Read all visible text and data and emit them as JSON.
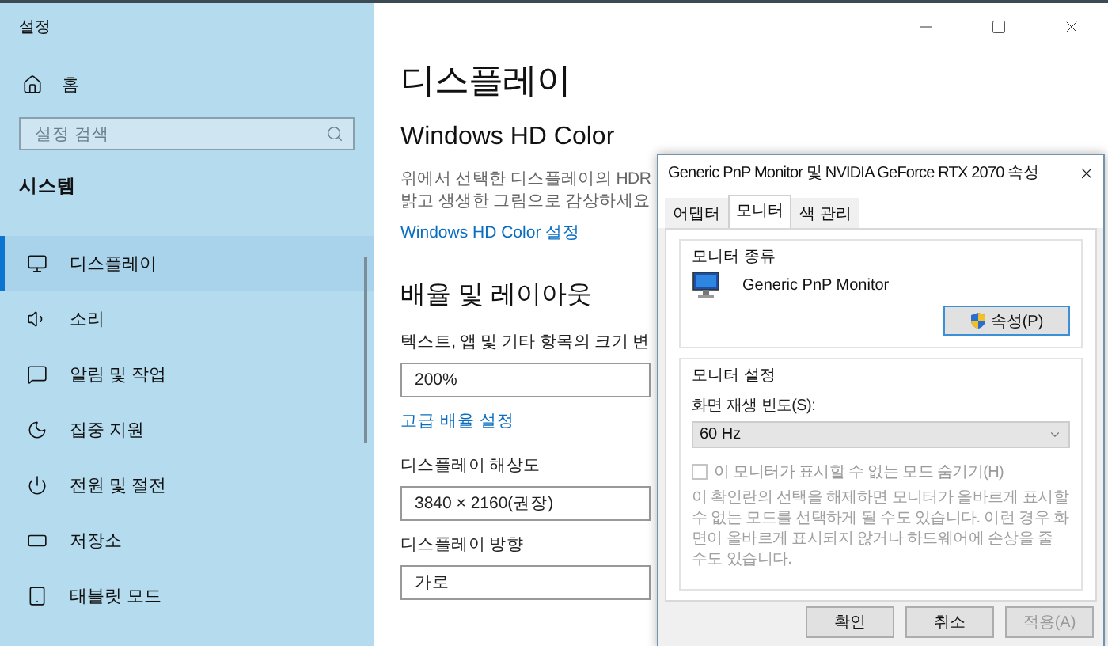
{
  "window": {
    "title": "설정"
  },
  "sidebar": {
    "home": "홈",
    "search": {
      "placeholder": "설정 검색"
    },
    "section": "시스템",
    "items": [
      {
        "label": "디스플레이",
        "kind": "monitor",
        "selected": true
      },
      {
        "label": "소리",
        "kind": "speaker",
        "selected": false
      },
      {
        "label": "알림 및 작업",
        "kind": "message",
        "selected": false
      },
      {
        "label": "집중 지원",
        "kind": "moon",
        "selected": false
      },
      {
        "label": "전원 및 절전",
        "kind": "power",
        "selected": false
      },
      {
        "label": "저장소",
        "kind": "storage",
        "selected": false
      },
      {
        "label": "태블릿 모드",
        "kind": "tablet",
        "selected": false
      }
    ]
  },
  "main": {
    "title": "디스플레이",
    "hdr": {
      "heading": "Windows HD Color",
      "description_lines": [
        "위에서 선택한 디스플레이의 HDR",
        "밝고 생생한 그림으로 감상하세요"
      ],
      "link": "Windows HD Color 설정"
    },
    "scale": {
      "heading": "배율 및 레이아웃",
      "field_label": "텍스트, 앱 및 기타 항목의 크기 변",
      "value": "200%",
      "link": "고급 배율 설정"
    },
    "resolution": {
      "label": "디스플레이 해상도",
      "value": "3840 × 2160(권장)"
    },
    "orientation": {
      "label": "디스플레이 방향",
      "value": "가로"
    }
  },
  "dialog": {
    "title": "Generic PnP Monitor 및 NVIDIA GeForce RTX 2070 속성",
    "tabs": [
      {
        "label": "어댑터",
        "selected": false
      },
      {
        "label": "모니터",
        "selected": true
      },
      {
        "label": "색 관리",
        "selected": false
      }
    ],
    "monitor_type": {
      "heading": "모니터 종류",
      "name": "Generic PnP Monitor",
      "button": "속성(P)"
    },
    "monitor_settings": {
      "heading": "모니터 설정",
      "refresh_label": "화면 재생 빈도(S):",
      "refresh_value": "60 Hz",
      "hide_modes": {
        "label": "이 모니터가 표시할 수 없는 모드 숨기기(H)",
        "checked": false,
        "disabled": true
      },
      "description": "이 확인란의 선택을 해제하면 모니터가 올바르게 표시할 수 없는 모드를 선택하게 될 수도 있습니다. 이런 경우 화면이 올바르게 표시되지 않거나 하드웨어에 손상을 줄 수도 있습니다."
    },
    "buttons": [
      {
        "label": "확인",
        "disabled": false
      },
      {
        "label": "취소",
        "disabled": false
      },
      {
        "label": "적용(A)",
        "disabled": true
      }
    ]
  }
}
